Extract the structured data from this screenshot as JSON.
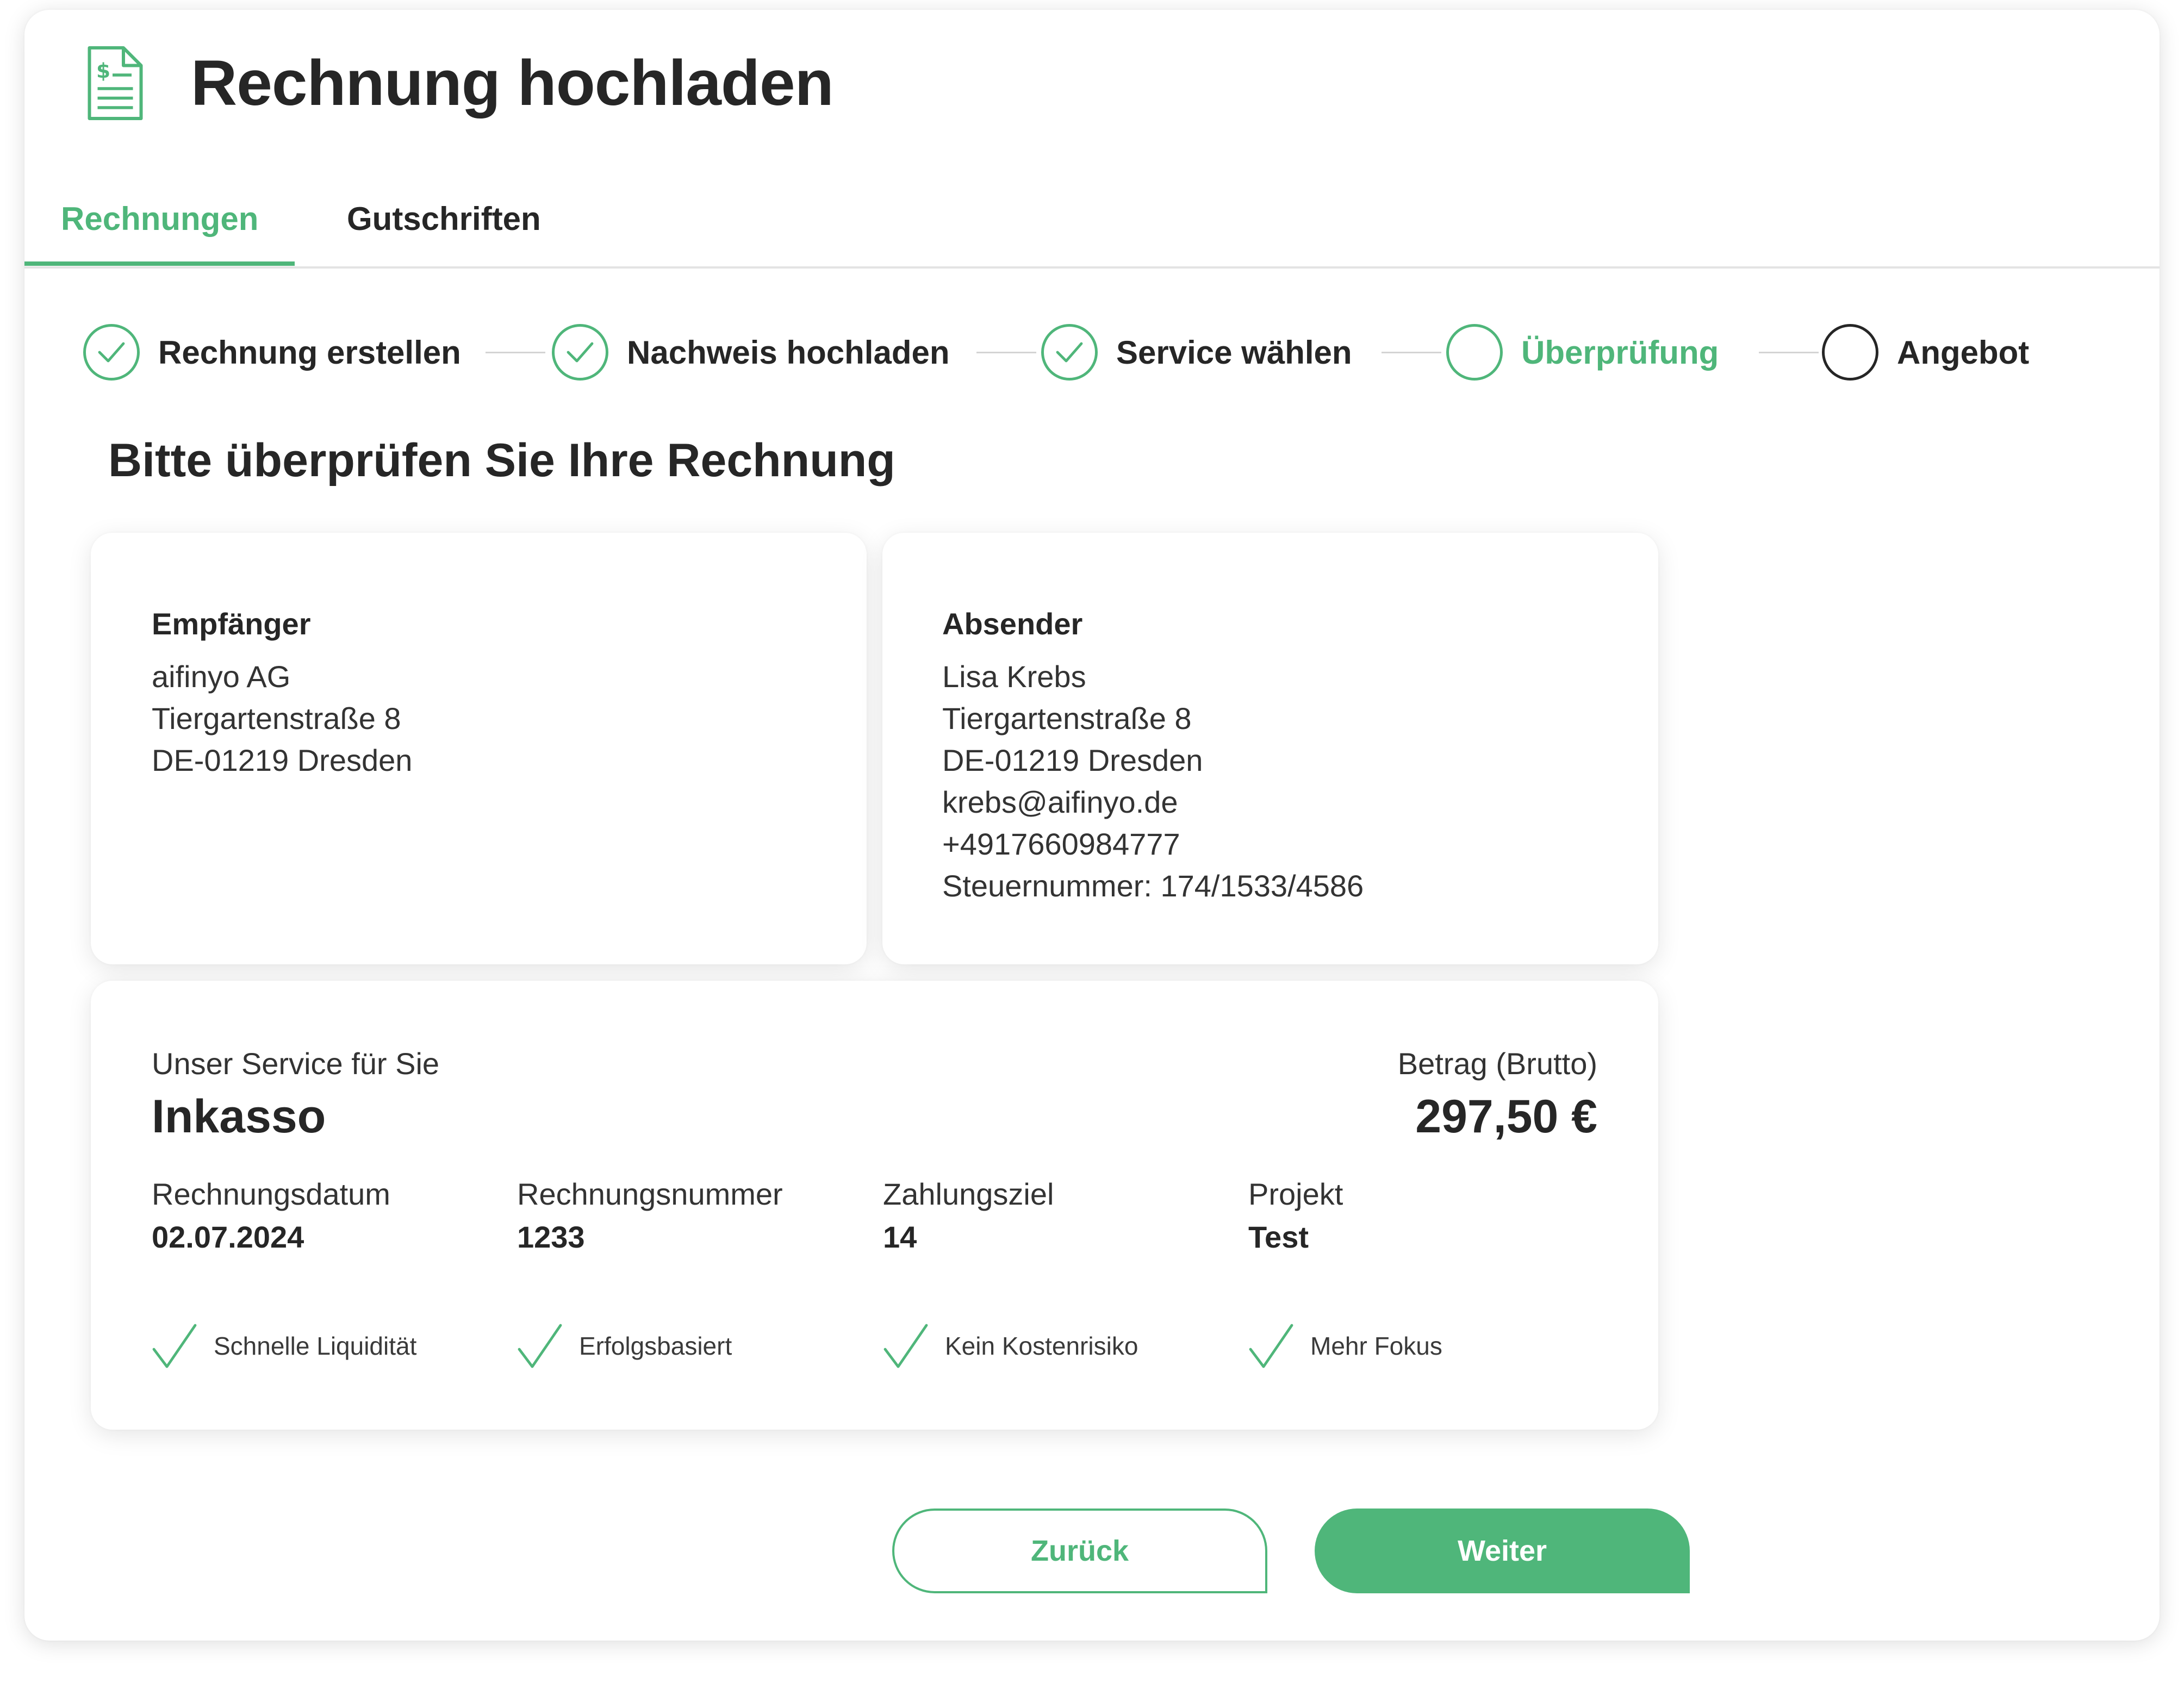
{
  "header": {
    "title": "Rechnung hochladen",
    "icon": "invoice-document-icon"
  },
  "tabs": [
    {
      "label": "Rechnungen",
      "active": true
    },
    {
      "label": "Gutschriften",
      "active": false
    }
  ],
  "stepper": {
    "steps": [
      {
        "label": "Rechnung erstellen",
        "state": "done"
      },
      {
        "label": "Nachweis hochladen",
        "state": "done"
      },
      {
        "label": "Service wählen",
        "state": "done"
      },
      {
        "label": "Überprüfung",
        "state": "current"
      },
      {
        "label": "Angebot",
        "state": "todo"
      }
    ]
  },
  "main": {
    "heading": "Bitte überprüfen Sie Ihre Rechnung",
    "recipient": {
      "title": "Empfänger",
      "lines": [
        "aifinyo AG",
        "Tiergartenstraße 8",
        "DE-01219 Dresden"
      ]
    },
    "sender": {
      "title": "Absender",
      "lines": [
        "Lisa Krebs",
        "Tiergartenstraße 8",
        "DE-01219 Dresden",
        "krebs@aifinyo.de",
        "+4917660984777",
        "Steuernummer: 174/1533/4586"
      ]
    },
    "service": {
      "caption": "Unser Service für Sie",
      "name": "Inkasso",
      "amount_caption": "Betrag (Brutto)",
      "amount": "297,50 €",
      "details": [
        {
          "label": "Rechnungsdatum",
          "value": "02.07.2024"
        },
        {
          "label": "Rechnungsnummer",
          "value": "1233"
        },
        {
          "label": "Zahlungsziel",
          "value": "14"
        },
        {
          "label": "Projekt",
          "value": "Test"
        }
      ],
      "features": [
        "Schnelle Liquidität",
        "Erfolgsbasiert",
        "Kein Kostenrisiko",
        "Mehr Fokus"
      ]
    }
  },
  "actions": {
    "back_label": "Zurück",
    "next_label": "Weiter"
  },
  "colors": {
    "accent": "#4fb67a",
    "text": "#262626",
    "divider": "#e3e3e3",
    "connector": "#d4d4d4"
  }
}
